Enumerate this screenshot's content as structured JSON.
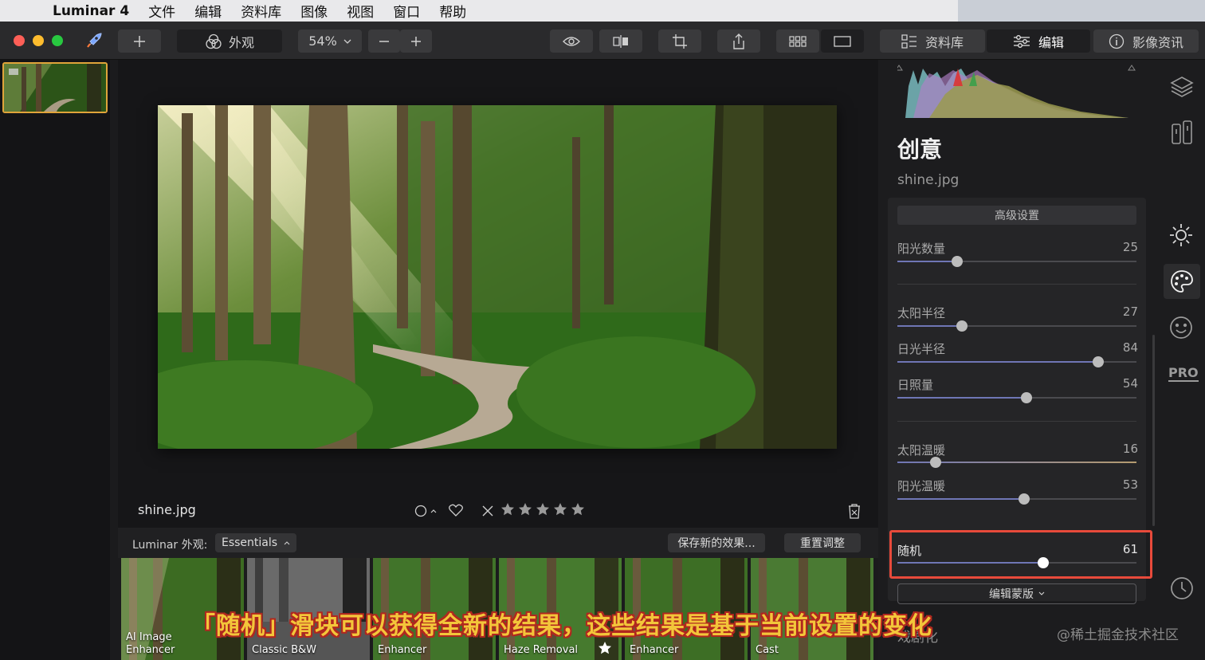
{
  "menubar": {
    "app_name": "Luminar 4",
    "items": [
      "文件",
      "编辑",
      "资料库",
      "图像",
      "视图",
      "窗口",
      "帮助"
    ]
  },
  "toolbar": {
    "looks_label": "外观",
    "zoom": "54%",
    "tabs": [
      {
        "label": "资料库"
      },
      {
        "label": "编辑"
      },
      {
        "label": "影像资讯"
      }
    ]
  },
  "info": {
    "filename": "shine.jpg"
  },
  "looksbar": {
    "label": "Luminar 外观:",
    "collection": "Essentials",
    "save_label": "保存新的效果...",
    "reset_label": "重置调整",
    "presets": [
      {
        "line1": "AI Image",
        "line2": "Enhancer"
      },
      {
        "line1": "",
        "line2": "Classic B&W"
      },
      {
        "line1": "",
        "line2": "Enhancer"
      },
      {
        "line1": "",
        "line2": "Haze Removal"
      },
      {
        "line1": "",
        "line2": "Enhancer"
      },
      {
        "line1": "",
        "line2": "Cast"
      }
    ]
  },
  "panel": {
    "title": "创意",
    "filename": "shine.jpg",
    "advanced_label": "高级设置",
    "sliders": [
      {
        "label": "阳光数量",
        "value": "25",
        "fraction": 0.25
      },
      {
        "label": "太阳半径",
        "value": "27",
        "fraction": 0.27
      },
      {
        "label": "日光半径",
        "value": "84",
        "fraction": 0.84
      },
      {
        "label": "日照量",
        "value": "54",
        "fraction": 0.54
      },
      {
        "label": "太阳温暖",
        "value": "16",
        "fraction": 0.16
      },
      {
        "label": "阳光温暖",
        "value": "53",
        "fraction": 0.53
      },
      {
        "label": "随机",
        "value": "61",
        "fraction": 0.61
      }
    ],
    "mask_label": "编辑蒙版",
    "next_section": "戏剧化",
    "pro_label": "PRO"
  },
  "overlay": {
    "caption": "「随机」滑块可以获得全新的结果，这些结果是基于当前设置的变化",
    "watermark": "@稀土掘金技术社区"
  },
  "colors": {
    "accent_highlight": "#e84a3b",
    "thumb_border": "#e0a43a",
    "slider_fill": "#6f76b5"
  }
}
